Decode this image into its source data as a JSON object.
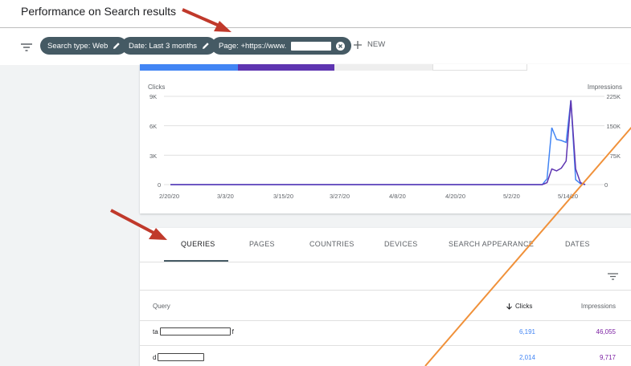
{
  "header": {
    "title": "Performance on Search results"
  },
  "filters": {
    "chips": [
      {
        "label": "Search type: Web"
      },
      {
        "label": "Date: Last 3 months"
      },
      {
        "label": "Page: +https://www."
      }
    ],
    "new_label": "NEW"
  },
  "chart": {
    "left_axis_label": "Clicks",
    "right_axis_label": "Impressions",
    "left_ticks": [
      "9K",
      "6K",
      "3K",
      "0"
    ],
    "right_ticks": [
      "225K",
      "150K",
      "75K",
      "0"
    ],
    "x_ticks": [
      "2/20/20",
      "3/3/20",
      "3/15/20",
      "3/27/20",
      "4/8/20",
      "4/20/20",
      "5/2/20",
      "5/14/20"
    ],
    "colors": {
      "clicks": "#4285f4",
      "impressions": "#5e35b1"
    }
  },
  "chart_data": {
    "type": "line",
    "x": [
      "2/20/20",
      "3/3/20",
      "3/15/20",
      "3/27/20",
      "4/8/20",
      "4/20/20",
      "5/2/20",
      "5/8/20",
      "5/9/20",
      "5/10/20",
      "5/11/20",
      "5/12/20",
      "5/13/20",
      "5/14/20",
      "5/15/20",
      "5/16/20",
      "5/17/20"
    ],
    "series": [
      {
        "name": "Clicks",
        "axis": "left",
        "values": [
          0,
          0,
          0,
          0,
          0,
          0,
          0,
          0,
          600,
          5800,
          4600,
          4500,
          4300,
          8600,
          500,
          100,
          0
        ]
      },
      {
        "name": "Impressions",
        "axis": "right",
        "values": [
          0,
          0,
          0,
          0,
          0,
          0,
          0,
          0,
          5000,
          40000,
          35000,
          42000,
          60000,
          215000,
          40000,
          5000,
          0
        ]
      }
    ],
    "ylim_left": [
      0,
      9000
    ],
    "ylim_right": [
      0,
      225000
    ]
  },
  "tabs": [
    "QUERIES",
    "PAGES",
    "COUNTRIES",
    "DEVICES",
    "SEARCH APPEARANCE",
    "DATES"
  ],
  "table": {
    "headers": {
      "query": "Query",
      "clicks": "Clicks",
      "impressions": "Impressions"
    },
    "rows": [
      {
        "prefix": "ta",
        "suffix": "f",
        "clicks": "6,191",
        "impressions": "46,055"
      },
      {
        "prefix": "d",
        "suffix": "",
        "clicks": "2,014",
        "impressions": "9,717"
      }
    ],
    "clicks_color": "#4285f4",
    "impressions_color": "#7b1fa2"
  }
}
